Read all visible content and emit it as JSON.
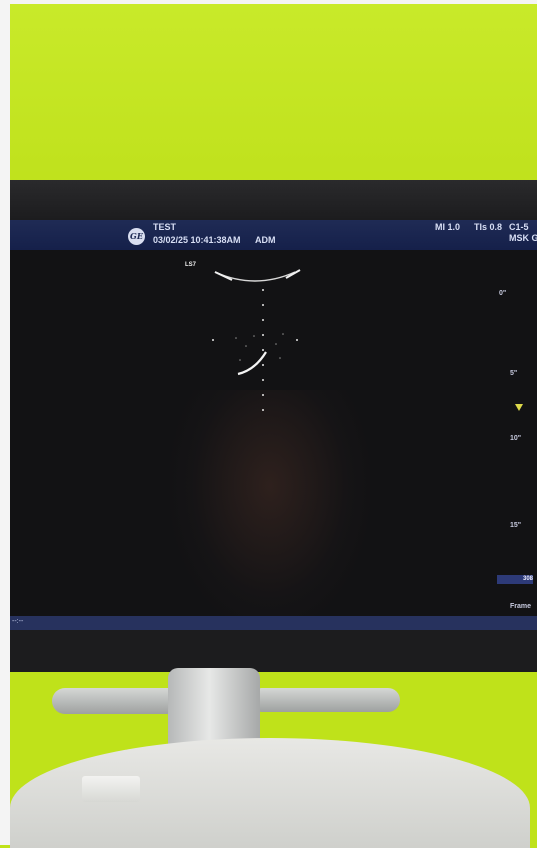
{
  "screen": {
    "header": {
      "patient_name": "TEST",
      "datetime": "03/02/25 10:41:38AM",
      "operator": "ADM",
      "mi": "MI 1.0",
      "tis": "TIs 0.8",
      "probe": "C1-5",
      "preset": "MSK G"
    },
    "image": {
      "probe_label": "LS7"
    },
    "side_panel": {
      "depth_labels": [
        "0\"",
        "5\"",
        "10\"",
        "15\""
      ],
      "value_box": "308",
      "frame_label": "Frame"
    },
    "bottom_bar": {
      "left_text": "--:--"
    }
  },
  "colors": {
    "wall": "#bfe21a",
    "header_bar": "#1f2b55",
    "focus_marker": "#ddd94a"
  }
}
